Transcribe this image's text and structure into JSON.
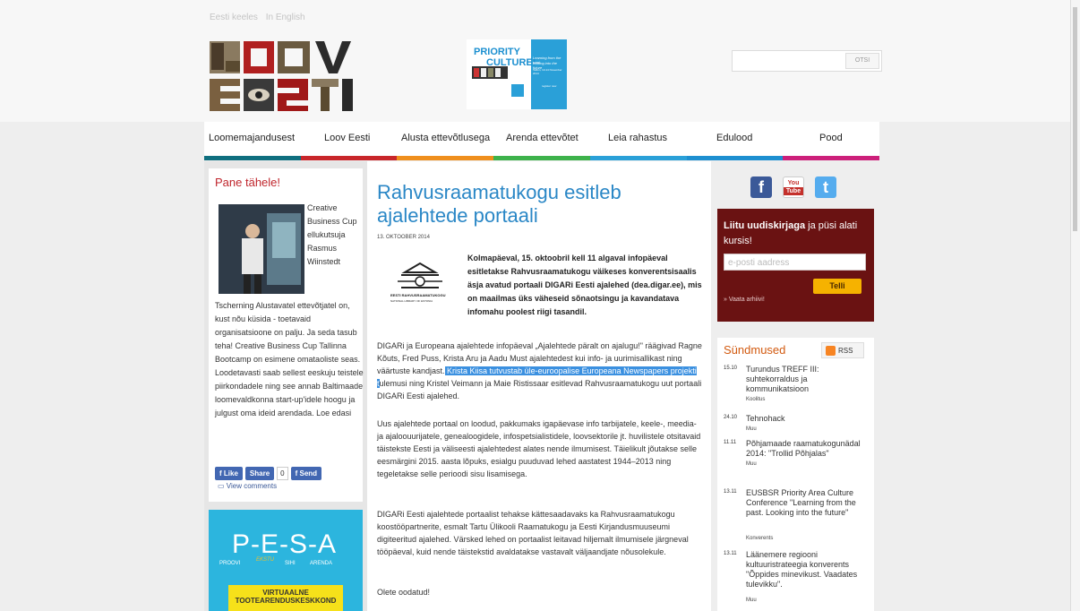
{
  "header": {
    "lang": [
      "Eesti keeles",
      "In English"
    ],
    "banner": {
      "line1": "PRIORITY",
      "line2": "CULTURE!",
      "right1": "Learning from the past,",
      "right2": "looking into the future",
      "right3": "Tallinn, 13-14 November 2014",
      "register": "register now"
    },
    "search_button": "OTSI"
  },
  "nav": {
    "items": [
      "Loomemajandusest",
      "Loov Eesti",
      "Alusta ettevõtlusega",
      "Arenda ettevõtet",
      "Leia rahastus",
      "Edulood",
      "Pood"
    ],
    "bar_colors": [
      "#b81b2b",
      "#c5262a",
      "#e85a1a",
      "#f08a1b",
      "#3eb24b",
      "#1d9fd8",
      "#6b2f84"
    ]
  },
  "left": {
    "title": "Pane tähele!",
    "caption": "Creative Business Cup ellukutsuja Rasmus Wiinstedt",
    "text": "Tscherning Alustavatel ettevõtjatel on, kust nõu küsida - toetavaid organisatsioone on palju. Ja seda tasub teha! Creative Business Cup Tallinna Bootcamp on esimene omataoliste seas. Loodetavasti saab sellest eeskuju teistele piirkondadele ning see annab Baltimaade loomevaldkonna start-up'idele hoogu ja julgust oma ideid arendada. Loe edasi",
    "fb": {
      "like": "Like",
      "share": "Share",
      "count": "0",
      "send": "Send"
    },
    "comments": "View comments",
    "pesa": {
      "logo": "P-E-S-A",
      "words": [
        "PROOVI",
        "EKSTU",
        "SIHI",
        "ARENDA"
      ],
      "cta_line1": "VIRTUAALNE",
      "cta_line2": "TOOTEARENDUSKESKKOND"
    }
  },
  "article": {
    "title": "Rahvusraamatukogu esitleb ajalehtede portaali",
    "date": "13. OKTOOBER 2014",
    "lib_name1": "EESTI RAHVUSRAAMATUKOGU",
    "lib_name2": "NATIONAL LIBRARY OF ESTONIA",
    "lead": "Kolmapäeval, 15. oktoobril kell 11 algaval infopäeval esitletakse Rahvusraamatukogu väikeses konverentsisaalis äsja avatud portaali DIGARi Eesti ajalehed (dea.digar.ee), mis on maailmas üks väheseid sõnaotsingu ja kavandatava infomahu poolest riigi tasandil.",
    "p1_a": "DIGARi ja Europeana ajalehtede infopäeval „Ajalehtede päralt on ajalugu!\" räägivad Ragne Kõuts, Fred Puss, Krista Aru ja Aadu Must ajalehtedest kui info- ja uurimisallikast ning väärtuste kandjast.",
    "p1_hl": " Krista Kiisa tutvustab üle-euroopalise Europeana Newspapers projekti t",
    "p1_b": "ulemusi ning Kristel Veimann ja Maie Ristissaar esitlevad Rahvusraamatukogu uut portaali DIGARi Eesti ajalehed.",
    "p2": "Uus ajalehtede portaal on loodud, pakkumaks igapäevase info tarbijatele, keele-, meedia- ja ajaloouurijatele, genealoogidele, infospetsialistidele, loovsektorile jt. huvilistele otsitavaid täistekste Eesti ja väliseesti ajalehtedest alates nende ilmumisest. Täielikult jõutakse selle eesmärgini 2015. aasta lõpuks, esialgu puuduvad lehed aastatest 1944–2013 ning tegeletakse selle perioodi sisu lisamisega.",
    "p3": "DIGARi Eesti ajalehtede portaalist tehakse kättesaadavaks ka Rahvusraamatukogu koostööpartnerite, esmalt Tartu Ülikooli Raamatukogu ja Eesti Kirjandusmuuseumi digiteeritud ajalehed. Värsked lehed on portaalist leitavad hiljemalt ilmumisele järgneval tööpäeval, kuid nende täistekstid avaldatakse vastavalt väljaandjate nõusolekule.",
    "p4": "Olete oodatud!"
  },
  "right": {
    "social": {
      "fb": "f",
      "yt_line1": "You",
      "yt_line2": "Tube",
      "tw": "t"
    },
    "newsletter": {
      "title_bold": "Liitu uudiskirjaga",
      "title_rest": " ja püsi alati kursis!",
      "placeholder": "e-posti aadress",
      "button": "Telli",
      "archive": "» Vaata arhiivi!"
    },
    "events_title": "Sündmused",
    "rss": "RSS",
    "events": [
      {
        "date": "15.10",
        "title": "Turundus TREFF III: suhtekorraldus ja kommunikatsioon",
        "type": "Koolitus"
      },
      {
        "date": "24.10",
        "title": "Tehnohack",
        "type": "Muu"
      },
      {
        "date": "11.11",
        "title": "Põhjamaade raamatukogunädal 2014: \"Trollid Põhjalas\"",
        "type": "Muu"
      },
      {
        "date": "13.11",
        "title": "EUSBSR Priority Area Culture Conference \"Learning from the past. Looking into the future\"",
        "type": "Konverents"
      },
      {
        "date": "13.11",
        "title": "Läänemere regiooni kultuuristrateegia konverents \"Õppides minevikust. Vaadates tulevikku\".",
        "type": "Muu"
      }
    ]
  }
}
